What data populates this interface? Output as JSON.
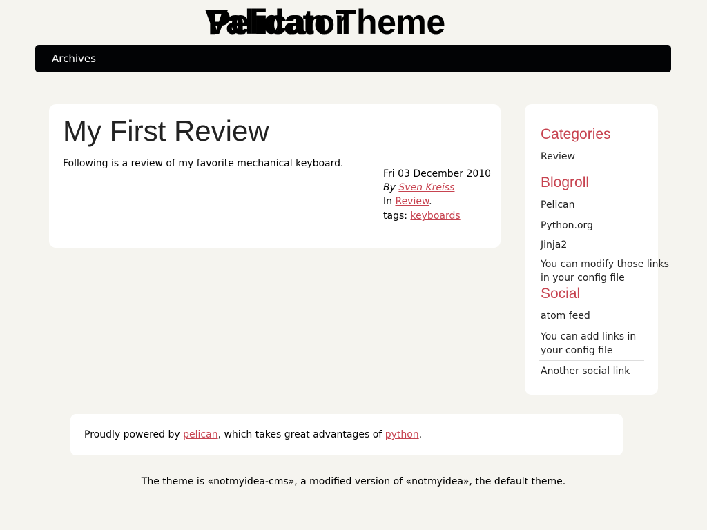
{
  "site": {
    "title_layers": [
      "Validator",
      "Pelican Theme"
    ]
  },
  "nav": {
    "items": [
      {
        "label": "Archives"
      }
    ]
  },
  "article": {
    "title": "My First Review",
    "summary": "Following is a review of my favorite mechanical keyboard.",
    "date": "Fri 03 December 2010",
    "by_label": "By",
    "author": "Sven Kreiss",
    "in_label": "In",
    "category": "Review",
    "category_suffix": ".",
    "tags_label": "tags:",
    "tag": "keyboards"
  },
  "sidebar": {
    "categories_title": "Categories",
    "categories": [
      "Review"
    ],
    "blogroll_title": "Blogroll",
    "blogroll": [
      "Pelican",
      "Python.org",
      "Jinja2"
    ],
    "blogroll_note": [
      "You can modify those links",
      "in your config file"
    ],
    "social_title": "Social",
    "social": [
      "atom feed"
    ],
    "social_note": [
      "You can add links in",
      "your config file"
    ],
    "social_more": [
      "Another social link"
    ]
  },
  "footer": {
    "prefix": "Proudly powered by ",
    "pelican": "pelican",
    "middle": ", which takes great advantages of ",
    "python": "python",
    "suffix": ".",
    "theme_note": "The theme is «notmyidea-cms», a modified version of «notmyidea», the default theme."
  },
  "colors": {
    "accent": "#c74350",
    "navbar": "#020305",
    "background": "#f5f4ef"
  }
}
